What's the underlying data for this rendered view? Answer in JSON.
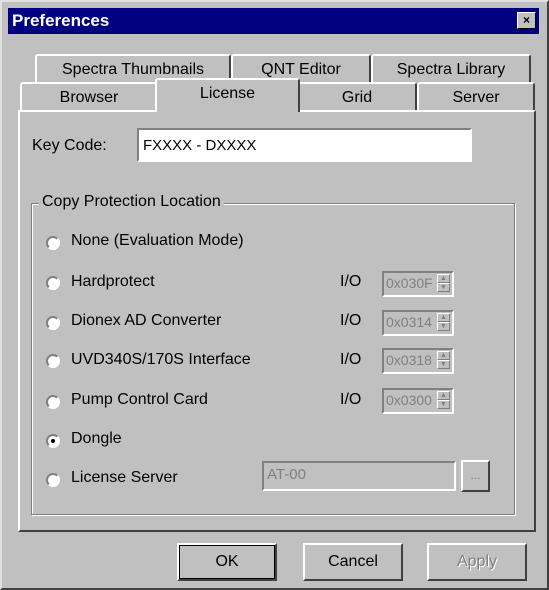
{
  "window": {
    "title": "Preferences",
    "close_label": "×"
  },
  "tabs_top": [
    "Spectra Thumbnails",
    "QNT Editor",
    "Spectra Library"
  ],
  "tabs_bottom": [
    "Browser",
    "License",
    "Grid",
    "Server"
  ],
  "active_tab": "License",
  "key_code": {
    "label": "Key Code:",
    "value": "FXXXX - DXXXX"
  },
  "group": {
    "caption": "Copy Protection Location",
    "options": [
      {
        "label": "None (Evaluation Mode)",
        "checked": false
      },
      {
        "label": "Hardprotect",
        "checked": false,
        "io_label": "I/O",
        "io_value": "0x030F"
      },
      {
        "label": "Dionex AD Converter",
        "checked": false,
        "io_label": "I/O",
        "io_value": "0x0314"
      },
      {
        "label": "UVD340S/170S Interface",
        "checked": false,
        "io_label": "I/O",
        "io_value": "0x0318"
      },
      {
        "label": "Pump Control Card",
        "checked": false,
        "io_label": "I/O",
        "io_value": "0x0300"
      },
      {
        "label": "Dongle",
        "checked": true
      },
      {
        "label": "License Server",
        "checked": false,
        "server_value": "AT-00",
        "browse_label": "..."
      }
    ]
  },
  "buttons": {
    "ok": "OK",
    "cancel": "Cancel",
    "apply": "Apply"
  }
}
